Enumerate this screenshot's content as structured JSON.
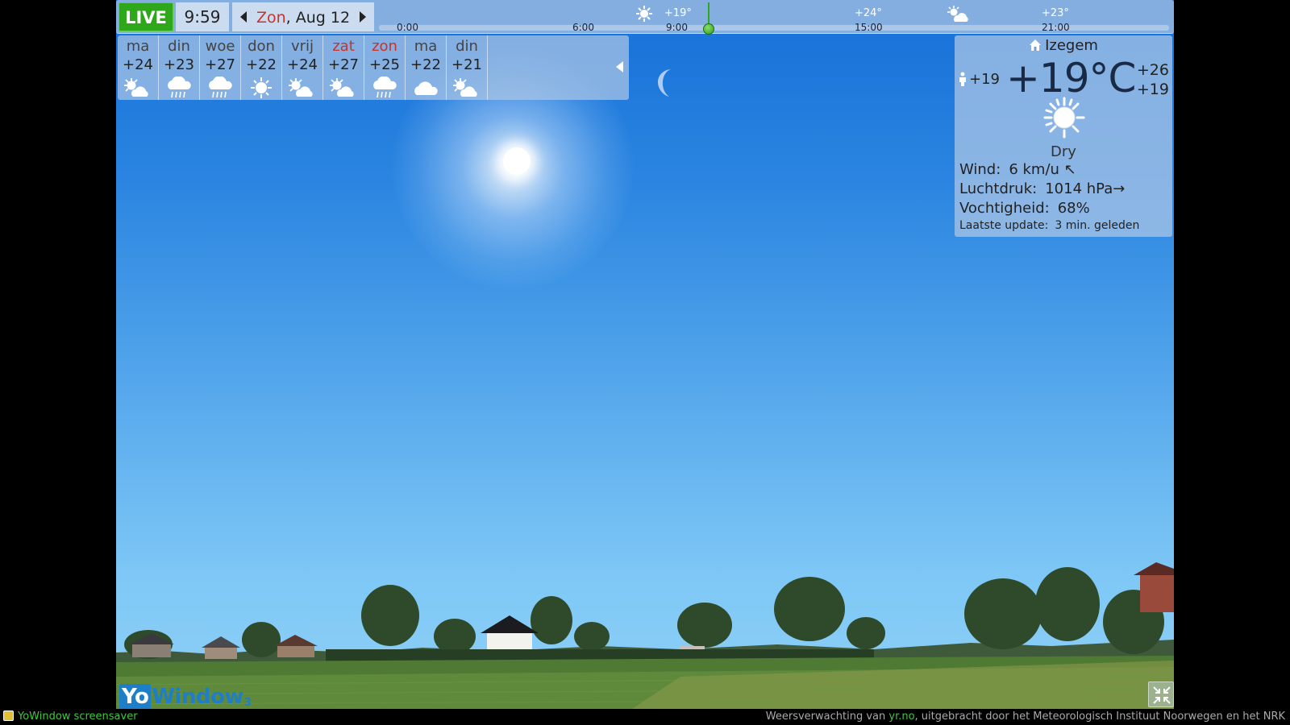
{
  "topbar": {
    "live_label": "LIVE",
    "time": "9:59",
    "date_weekday": "Zon",
    "date_rest": ", Aug 12",
    "timeline": {
      "ticks": [
        "0:00",
        "6:00",
        "9:00",
        "15:00",
        "21:00"
      ],
      "temps": [
        "+19°",
        "+24°",
        "+23°"
      ]
    }
  },
  "forecast": {
    "days": [
      {
        "name": "ma",
        "temp": "+24",
        "icon": "partly-cloudy-icon",
        "weekend": false
      },
      {
        "name": "din",
        "temp": "+23",
        "icon": "rain-icon",
        "weekend": false
      },
      {
        "name": "woe",
        "temp": "+27",
        "icon": "rain-icon",
        "weekend": false
      },
      {
        "name": "don",
        "temp": "+22",
        "icon": "sun-icon",
        "weekend": false
      },
      {
        "name": "vrij",
        "temp": "+24",
        "icon": "partly-cloudy-icon",
        "weekend": false
      },
      {
        "name": "zat",
        "temp": "+27",
        "icon": "partly-cloudy-icon",
        "weekend": true
      },
      {
        "name": "zon",
        "temp": "+25",
        "icon": "rain-icon",
        "weekend": true
      },
      {
        "name": "ma",
        "temp": "+22",
        "icon": "cloud-icon",
        "weekend": false
      },
      {
        "name": "din",
        "temp": "+21",
        "icon": "partly-cloudy-icon",
        "weekend": false
      }
    ]
  },
  "current": {
    "location": "Izegem",
    "feels_like": "+19",
    "temperature": "+19°C",
    "high": "+26",
    "low": "+19",
    "condition": "Dry",
    "wind_label": "Wind:",
    "wind_value": "6 km/u",
    "wind_arrow": "↖",
    "pressure_label": "Luchtdruk:",
    "pressure_value": "1014 hPa",
    "pressure_arrow": "→",
    "humidity_label": "Vochtigheid:",
    "humidity_value": "68%",
    "updated_label": "Laatste update:",
    "updated_value": "3 min. geleden"
  },
  "logo": {
    "yo": "Yo",
    "rest": "Window",
    "version": "3"
  },
  "footer": {
    "app_name": "YoWindow screensaver",
    "credit_prefix": "Weersverwachting van ",
    "credit_link": "yr.no",
    "credit_suffix": ", uitgebracht door het Meteorologisch Instituut Noorwegen en het NRK"
  },
  "colors": {
    "live": "#2ea81a",
    "weekend": "#c8332a",
    "link": "#3fc83f",
    "brand": "#1e7fc8"
  }
}
